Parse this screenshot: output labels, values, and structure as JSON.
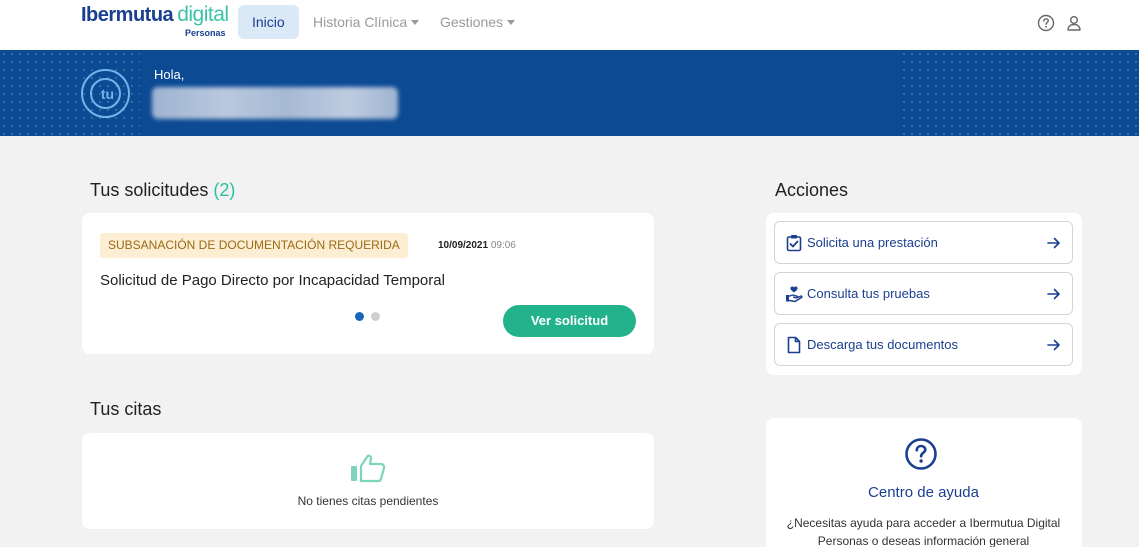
{
  "navbar": {
    "logo_brand": "Ibermutua",
    "logo_digital": "digital",
    "logo_sub": "Personas",
    "tabs": [
      {
        "label": "Inicio",
        "active": true
      },
      {
        "label": "Historia Clínica",
        "dropdown": true
      },
      {
        "label": "Gestiones",
        "dropdown": true
      }
    ],
    "icons": [
      "help-circle-icon",
      "user-icon"
    ]
  },
  "banner": {
    "greeting": "Hola,",
    "avatar_text": "tu"
  },
  "solicitudes": {
    "title": "Tus solicitudes",
    "count": "(2)",
    "card": {
      "status_badge": "SUBSANACIÓN DE DOCUMENTACIÓN REQUERIDA",
      "date": "10/09/2021",
      "time": "09:06",
      "title": "Solicitud de Pago Directo por Incapacidad Temporal",
      "carousel": {
        "pages": 2,
        "current": 1
      },
      "button_label": "Ver solicitud"
    }
  },
  "citas": {
    "title": "Tus citas",
    "empty_text": "No tienes citas pendientes"
  },
  "acciones": {
    "title": "Acciones",
    "items": [
      {
        "label": "Solicita una prestación",
        "icon": "clipboard-check-icon"
      },
      {
        "label": "Consulta tus pruebas",
        "icon": "hand-heart-icon"
      },
      {
        "label": "Descarga tus documentos",
        "icon": "document-icon"
      }
    ]
  },
  "ayuda": {
    "title": "Centro de ayuda",
    "text": "¿Necesitas ayuda para acceder a Ibermutua Digital Personas o deseas información general"
  },
  "colors": {
    "primary": "#1b3f8f",
    "banner": "#0c4a94",
    "accent_green": "#22b28c",
    "badge_bg": "#fbeed2",
    "badge_text": "#9c6a17"
  }
}
